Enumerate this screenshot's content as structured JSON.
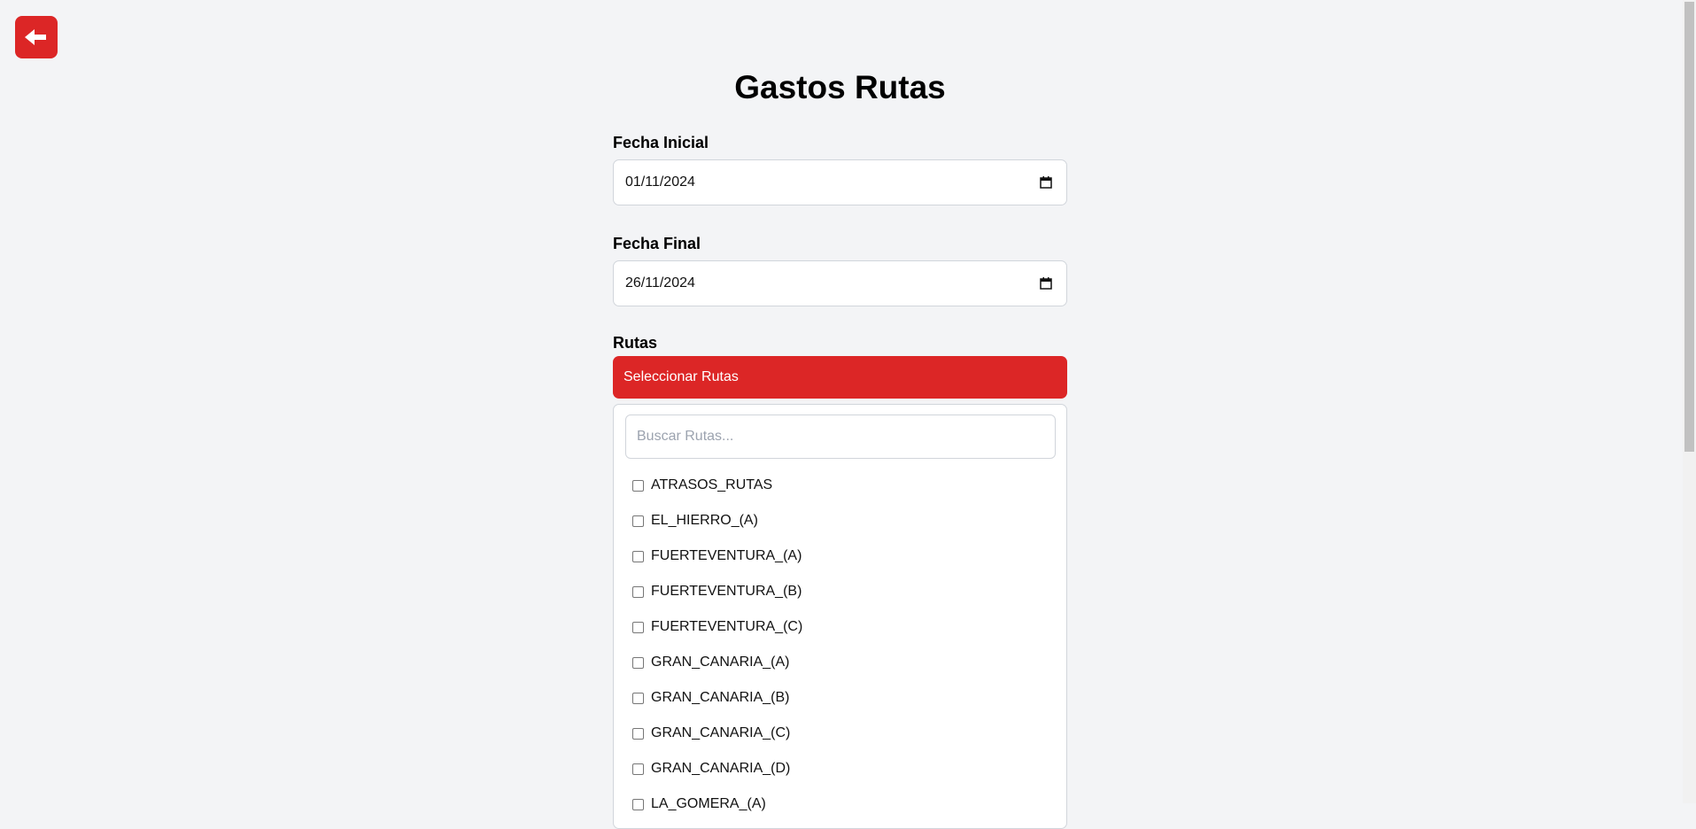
{
  "header": {
    "back_icon": "arrow-left-icon",
    "title": "Gastos Rutas"
  },
  "form": {
    "start_date": {
      "label": "Fecha Inicial",
      "value": "01/11/2024",
      "icon": "calendar-icon"
    },
    "end_date": {
      "label": "Fecha Final",
      "value": "26/11/2024",
      "icon": "calendar-icon"
    },
    "routes": {
      "label": "Rutas",
      "select_button_label": "Seleccionar Rutas",
      "search_placeholder": "Buscar Rutas...",
      "items": [
        {
          "label": "ATRASOS_RUTAS",
          "checked": false
        },
        {
          "label": "EL_HIERRO_(A)",
          "checked": false
        },
        {
          "label": "FUERTEVENTURA_(A)",
          "checked": false
        },
        {
          "label": "FUERTEVENTURA_(B)",
          "checked": false
        },
        {
          "label": "FUERTEVENTURA_(C)",
          "checked": false
        },
        {
          "label": "GRAN_CANARIA_(A)",
          "checked": false
        },
        {
          "label": "GRAN_CANARIA_(B)",
          "checked": false
        },
        {
          "label": "GRAN_CANARIA_(C)",
          "checked": false
        },
        {
          "label": "GRAN_CANARIA_(D)",
          "checked": false
        },
        {
          "label": "LA_GOMERA_(A)",
          "checked": false
        }
      ]
    }
  },
  "colors": {
    "accent": "#dc2626",
    "background": "#f3f4f6",
    "border": "#d1d5db"
  }
}
